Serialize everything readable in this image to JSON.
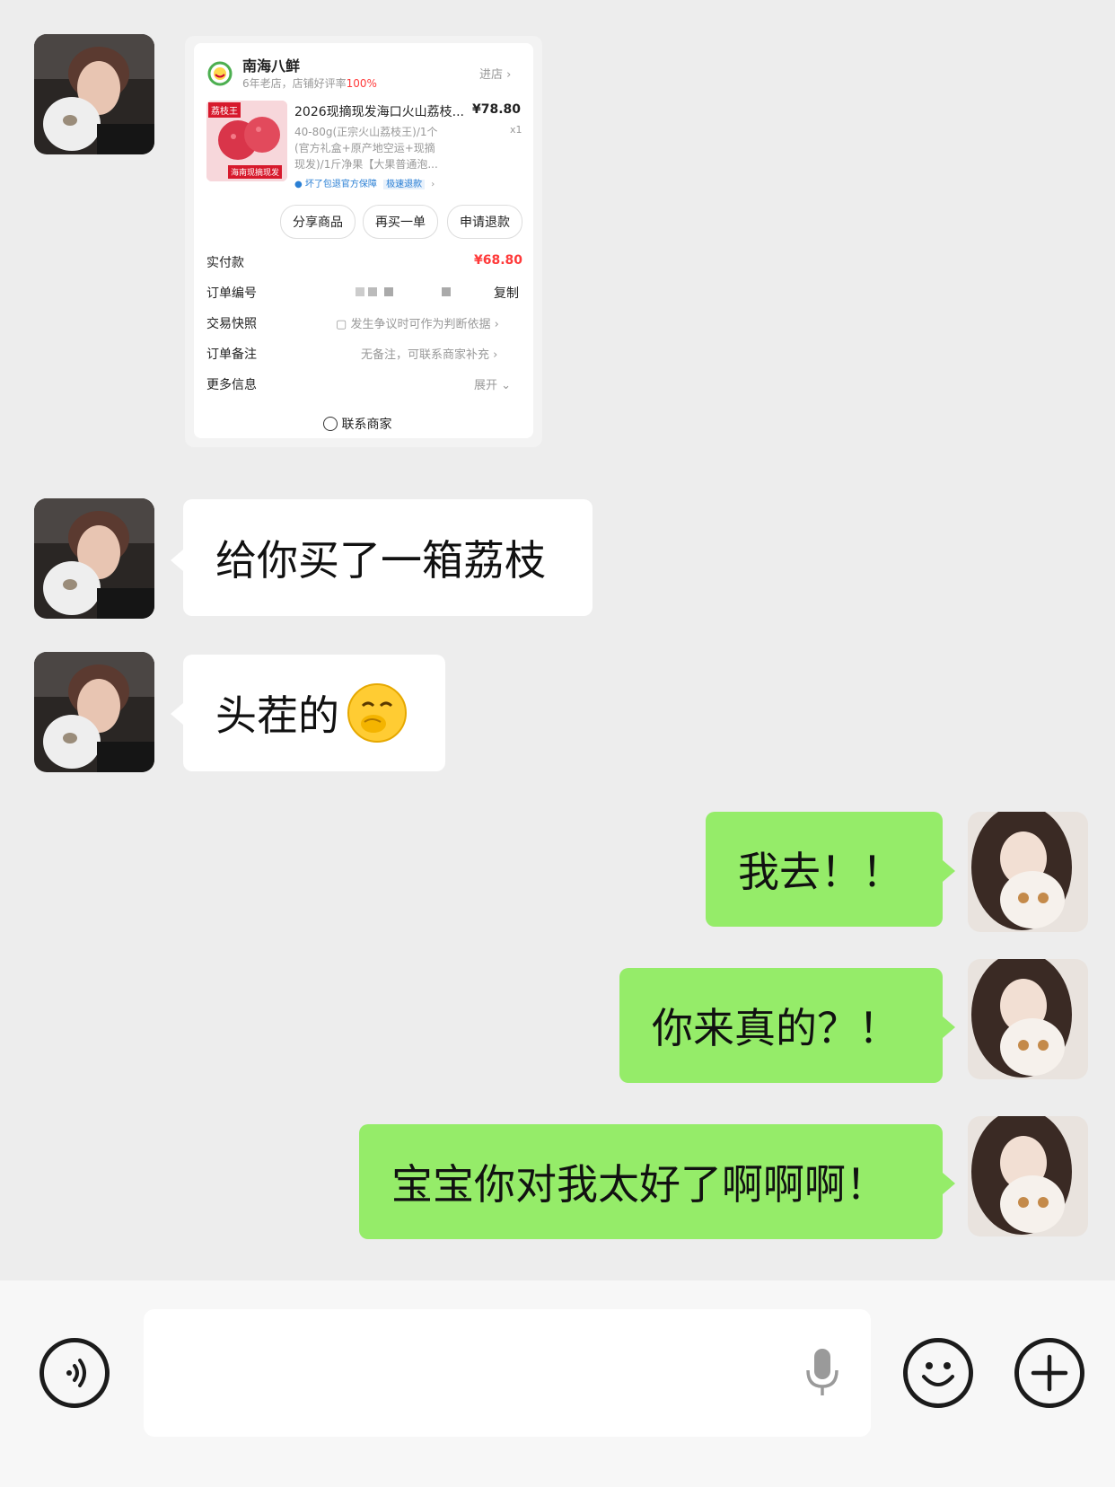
{
  "order_card": {
    "shop_name": "南海八鲜",
    "shop_meta_prefix": "6年老店，店铺好评率",
    "shop_rating": "100%",
    "enter_shop": "进店 ›",
    "product_title": "2026现摘现发海口火山荔枝...",
    "product_price": "¥78.80",
    "product_qty": "x1",
    "product_spec_line1": "40-80g(正宗火山荔枝王)/1个",
    "product_spec_line2": "(官方礼盒+原产地空运+现摘",
    "product_spec_line3": "现发)/1斤净果【大果普通泡...",
    "guarantee_1": "坏了包退官方保障",
    "guarantee_2": "极速退款",
    "thumb_label_top": "荔枝王",
    "thumb_label_bottom": "海南现摘现发",
    "btn_share": "分享商品",
    "btn_rebuy": "再买一单",
    "btn_refund": "申请退款",
    "paid_label": "实付款",
    "paid_value": "¥68.80",
    "order_no_label": "订单编号",
    "copy_label": "复制",
    "snapshot_label": "交易快照",
    "snapshot_value": "发生争议时可作为判断依据 ›",
    "remark_label": "订单备注",
    "remark_value": "无备注，可联系商家补充 ›",
    "more_label": "更多信息",
    "more_value": "展开 ⌄",
    "contact_label": "联系商家"
  },
  "messages": [
    {
      "side": "left",
      "text": "给你买了一箱荔枝"
    },
    {
      "side": "left",
      "text": "头茬的",
      "emoji": "🫢"
    },
    {
      "side": "right",
      "text": "我去！！"
    },
    {
      "side": "right",
      "text": "你来真的？！"
    },
    {
      "side": "right",
      "text": "宝宝你对我太好了啊啊啊！"
    }
  ],
  "colors": {
    "background": "#ededed",
    "sent_bubble": "#95ec69",
    "received_bubble": "#ffffff",
    "price_red": "#ff3a3a"
  },
  "bottom_bar": {
    "voice_icon": "voice-icon",
    "mic_icon": "mic-icon",
    "emoji_icon": "emoji-icon",
    "plus_icon": "plus-icon"
  }
}
